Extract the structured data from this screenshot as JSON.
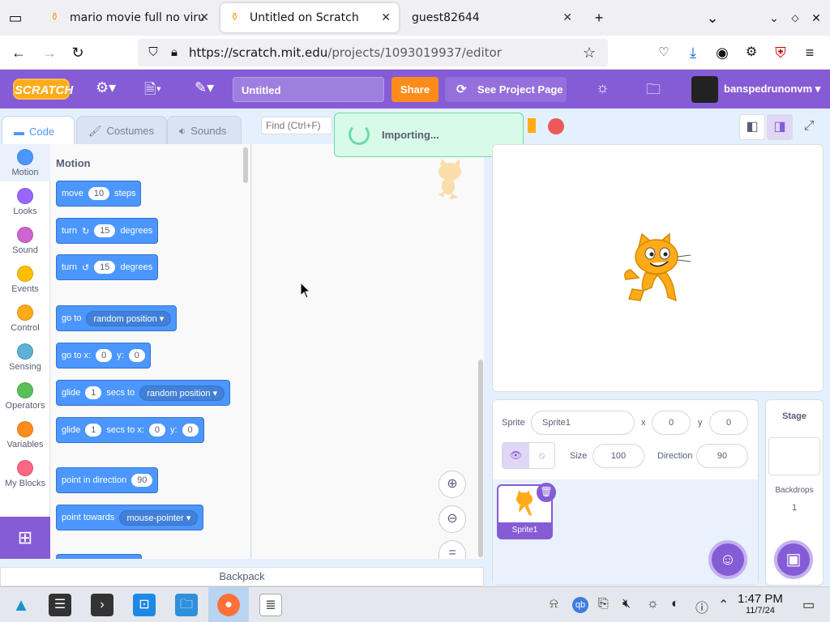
{
  "browser": {
    "tabs": [
      {
        "title": "mario movie full no virus f"
      },
      {
        "title": "Untitled on Scratch"
      },
      {
        "title": "guest82644"
      }
    ],
    "url_domain": "https://scratch.mit.edu",
    "url_path": "/projects/1093019937/editor"
  },
  "menu": {
    "logo": "SCRATCH",
    "project_title": "Untitled",
    "share_label": "Share",
    "see_project_label": "See Project Page",
    "username": "banspedrunonvm"
  },
  "editor_tabs": [
    "Code",
    "Costumes",
    "Sounds"
  ],
  "find_placeholder": "Find (Ctrl+F)",
  "toast": "Importing...",
  "categories": [
    {
      "label": "Motion",
      "color": "#4c97ff"
    },
    {
      "label": "Looks",
      "color": "#9966ff"
    },
    {
      "label": "Sound",
      "color": "#cf63cf"
    },
    {
      "label": "Events",
      "color": "#ffbf00"
    },
    {
      "label": "Control",
      "color": "#ffab19"
    },
    {
      "label": "Sensing",
      "color": "#5cb1d6"
    },
    {
      "label": "Operators",
      "color": "#59c059"
    },
    {
      "label": "Variables",
      "color": "#ff8c1a"
    },
    {
      "label": "My Blocks",
      "color": "#ff6680"
    }
  ],
  "palette": {
    "heading": "Motion",
    "move": {
      "a": "move",
      "v": "10",
      "b": "steps"
    },
    "turn_cw": {
      "a": "turn",
      "v": "15",
      "b": "degrees"
    },
    "turn_ccw": {
      "a": "turn",
      "v": "15",
      "b": "degrees"
    },
    "goto": {
      "a": "go to",
      "opt": "random position"
    },
    "gotoxy": {
      "a": "go to x:",
      "x": "0",
      "yl": "y:",
      "y": "0"
    },
    "glide1": {
      "a": "glide",
      "v": "1",
      "b": "secs to",
      "opt": "random position"
    },
    "glide2": {
      "a": "glide",
      "v": "1",
      "b": "secs to x:",
      "x": "0",
      "yl": "y:",
      "y": "0"
    },
    "point_dir": {
      "a": "point in direction",
      "v": "90"
    },
    "point_towards": {
      "a": "point towards",
      "opt": "mouse-pointer"
    }
  },
  "sprite_info": {
    "sprite_label": "Sprite",
    "sprite_name": "Sprite1",
    "x_label": "x",
    "x": "0",
    "y_label": "y",
    "y": "0",
    "size_label": "Size",
    "size": "100",
    "direction_label": "Direction",
    "direction": "90",
    "thumb_name": "Sprite1"
  },
  "stage_panel": {
    "title": "Stage",
    "backdrops_label": "Backdrops",
    "backdrops_count": "1"
  },
  "backpack": "Backpack",
  "clock": {
    "time": "1:47 PM",
    "date": "11/7/24"
  }
}
